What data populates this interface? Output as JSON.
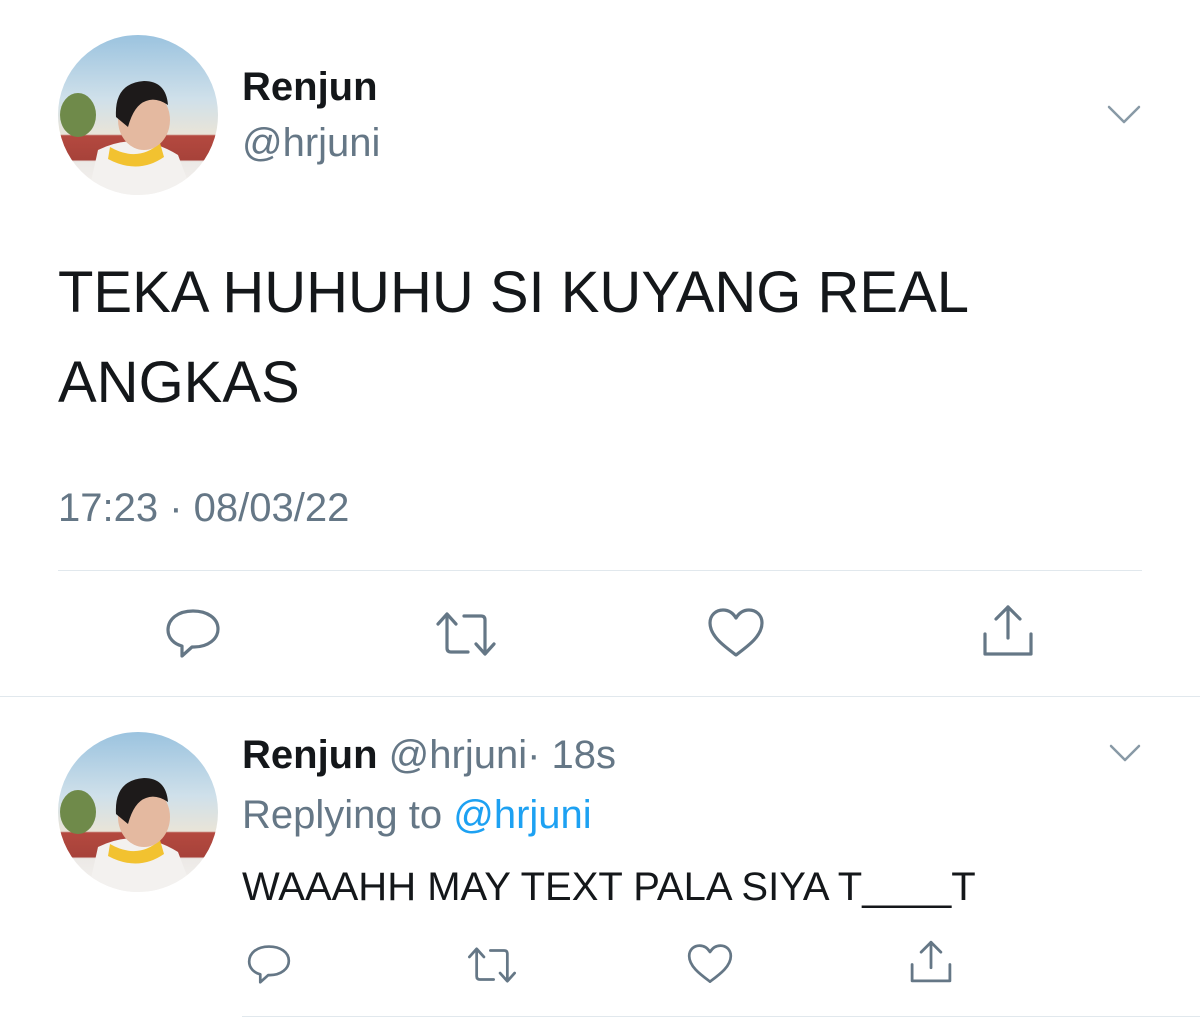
{
  "main_tweet": {
    "display_name": "Renjun",
    "handle": "@hrjuni",
    "text_line1": "TEKA HUHUHU SI KUYANG REAL",
    "text_line2": "ANGKAS",
    "timestamp": "17:23 · 08/03/22"
  },
  "reply_tweet": {
    "display_name": "Renjun",
    "handle": "@hrjuni",
    "age": "· 18s",
    "replying_prefix": "Replying to",
    "replying_handle": "@hrjuni",
    "text": "WAAAHH MAY TEXT PALA SIYA T____T"
  },
  "icons": {
    "caret": "chevron-down-icon",
    "reply": "reply-icon",
    "retweet": "retweet-icon",
    "like": "heart-icon",
    "share": "share-icon"
  },
  "colors": {
    "text": "#14171a",
    "muted": "#657786",
    "link": "#1da1f2",
    "divider": "#e1e8ed"
  }
}
